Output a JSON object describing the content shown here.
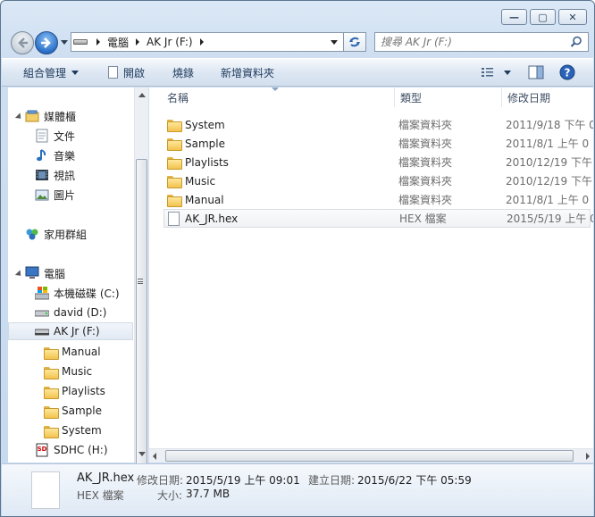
{
  "window": {
    "minimize": "—",
    "maximize": "▢",
    "close": "✕"
  },
  "address": {
    "root": "電腦",
    "current": "AK Jr (F:)"
  },
  "search": {
    "placeholder": "搜尋 AK Jr (F:)"
  },
  "toolbar": {
    "organize": "組合管理",
    "open": "開啟",
    "burn": "燒錄",
    "new_folder": "新增資料夾"
  },
  "sidebar": {
    "favorites": "媒體櫃",
    "documents": "文件",
    "music": "音樂",
    "videos": "視訊",
    "pictures": "圖片",
    "homegroup": "家用群組",
    "computer": "電腦",
    "drives": [
      {
        "label": "本機磁碟 (C:)"
      },
      {
        "label": "david (D:)"
      },
      {
        "label": "AK Jr (F:)"
      }
    ],
    "folders": [
      {
        "label": "Manual"
      },
      {
        "label": "Music"
      },
      {
        "label": "Playlists"
      },
      {
        "label": "Sample"
      },
      {
        "label": "System"
      }
    ],
    "sdhc": "SDHC (H:)",
    "sd_badge": "SD"
  },
  "columns": {
    "name": "名稱",
    "type": "類型",
    "date": "修改日期"
  },
  "files": [
    {
      "name": "System",
      "type": "檔案資料夾",
      "date": "2011/9/18 下午 0"
    },
    {
      "name": "Sample",
      "type": "檔案資料夾",
      "date": "2011/8/1 上午 0"
    },
    {
      "name": "Playlists",
      "type": "檔案資料夾",
      "date": "2010/12/19 下午"
    },
    {
      "name": "Music",
      "type": "檔案資料夾",
      "date": "2010/12/19 下午"
    },
    {
      "name": "Manual",
      "type": "檔案資料夾",
      "date": "2011/8/1 上午 0"
    },
    {
      "name": "AK_JR.hex",
      "type": "HEX 檔案",
      "date": "2015/5/19 上午 0"
    }
  ],
  "details": {
    "filename": "AK_JR.hex",
    "filetype": "HEX 檔案",
    "modified_label": "修改日期:",
    "modified_value": "2015/5/19 上午 09:01",
    "created_label": "建立日期:",
    "created_value": "2015/6/22 下午 05:59",
    "size_label": "大小:",
    "size_value": "37.7 MB"
  },
  "colors": {
    "accent": "#2a6fc7",
    "folder": "#f2c34f",
    "command_text": "#1e395b"
  }
}
